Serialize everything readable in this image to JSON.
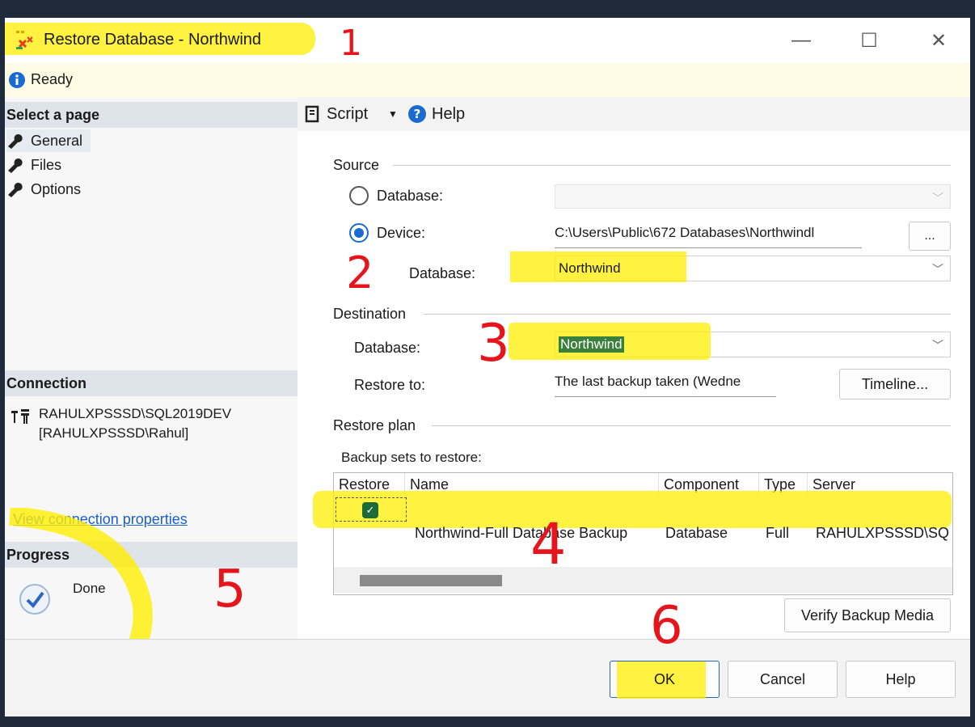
{
  "window": {
    "title": "Restore Database - Northwind",
    "controls": [
      "—",
      "☐",
      "✕"
    ]
  },
  "status": {
    "text": "Ready"
  },
  "left": {
    "select_page_header": "Select a page",
    "pages": [
      {
        "label": "General"
      },
      {
        "label": "Files"
      },
      {
        "label": "Options"
      }
    ],
    "connection_header": "Connection",
    "connection_server": "RAHULXPSSSD\\SQL2019DEV",
    "connection_user": "[RAHULXPSSSD\\Rahul]",
    "view_connection_link": "View connection properties",
    "progress_header": "Progress",
    "progress_status": "Done"
  },
  "toolbar": {
    "script_label": "Script",
    "help_label": "Help"
  },
  "source": {
    "group_label": "Source",
    "database_radio_label": "Database:",
    "database_value": "",
    "device_radio_label": "Device:",
    "device_path": "C:\\Users\\Public\\672 Databases\\Northwindl",
    "browse_label": "...",
    "device_database_label": "Database:",
    "device_database_value": "Northwind"
  },
  "destination": {
    "group_label": "Destination",
    "database_label": "Database:",
    "database_value": "Northwind",
    "restore_to_label": "Restore to:",
    "restore_to_value": "The last backup taken (Wedne",
    "timeline_label": "Timeline..."
  },
  "restore_plan": {
    "group_label": "Restore plan",
    "backup_sets_label": "Backup sets to restore:",
    "columns": [
      "Restore",
      "Name",
      "Component",
      "Type",
      "Server"
    ],
    "rows": [
      {
        "restore": true,
        "name": "Northwind-Full Database Backup",
        "component": "Database",
        "type": "Full",
        "server": "RAHULXPSSSD\\SQ"
      }
    ],
    "verify_label": "Verify Backup Media"
  },
  "footer": {
    "ok_label": "OK",
    "cancel_label": "Cancel",
    "help_label": "Help"
  },
  "annotations": [
    "1",
    "2",
    "3",
    "4",
    "5",
    "6"
  ],
  "colors": {
    "highlight": "#ffee00",
    "annotation": "#e6141b",
    "link": "#1a5fd0",
    "check": "#1e6b3a"
  }
}
